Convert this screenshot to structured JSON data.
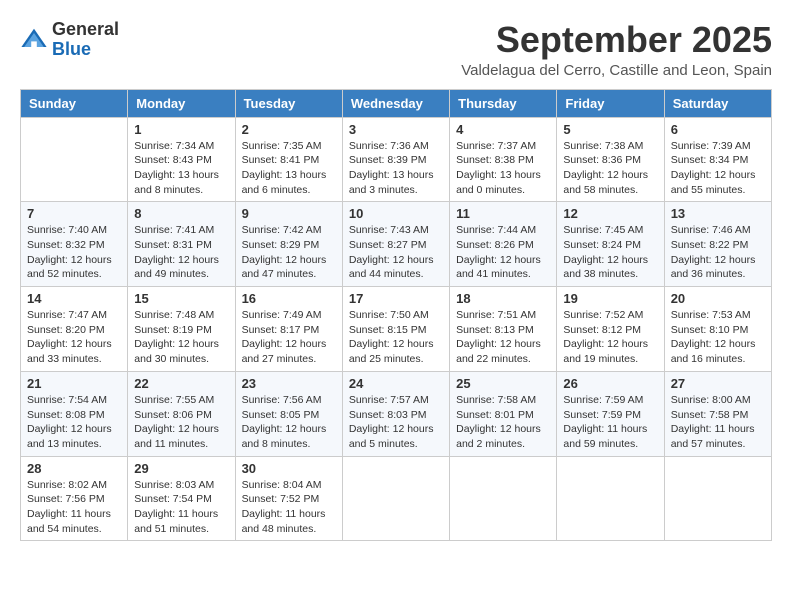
{
  "logo": {
    "general": "General",
    "blue": "Blue"
  },
  "title": "September 2025",
  "location": "Valdelagua del Cerro, Castille and Leon, Spain",
  "days_of_week": [
    "Sunday",
    "Monday",
    "Tuesday",
    "Wednesday",
    "Thursday",
    "Friday",
    "Saturday"
  ],
  "weeks": [
    [
      {
        "day": null
      },
      {
        "day": 1,
        "sunrise": "Sunrise: 7:34 AM",
        "sunset": "Sunset: 8:43 PM",
        "daylight": "Daylight: 13 hours and 8 minutes."
      },
      {
        "day": 2,
        "sunrise": "Sunrise: 7:35 AM",
        "sunset": "Sunset: 8:41 PM",
        "daylight": "Daylight: 13 hours and 6 minutes."
      },
      {
        "day": 3,
        "sunrise": "Sunrise: 7:36 AM",
        "sunset": "Sunset: 8:39 PM",
        "daylight": "Daylight: 13 hours and 3 minutes."
      },
      {
        "day": 4,
        "sunrise": "Sunrise: 7:37 AM",
        "sunset": "Sunset: 8:38 PM",
        "daylight": "Daylight: 13 hours and 0 minutes."
      },
      {
        "day": 5,
        "sunrise": "Sunrise: 7:38 AM",
        "sunset": "Sunset: 8:36 PM",
        "daylight": "Daylight: 12 hours and 58 minutes."
      },
      {
        "day": 6,
        "sunrise": "Sunrise: 7:39 AM",
        "sunset": "Sunset: 8:34 PM",
        "daylight": "Daylight: 12 hours and 55 minutes."
      }
    ],
    [
      {
        "day": 7,
        "sunrise": "Sunrise: 7:40 AM",
        "sunset": "Sunset: 8:32 PM",
        "daylight": "Daylight: 12 hours and 52 minutes."
      },
      {
        "day": 8,
        "sunrise": "Sunrise: 7:41 AM",
        "sunset": "Sunset: 8:31 PM",
        "daylight": "Daylight: 12 hours and 49 minutes."
      },
      {
        "day": 9,
        "sunrise": "Sunrise: 7:42 AM",
        "sunset": "Sunset: 8:29 PM",
        "daylight": "Daylight: 12 hours and 47 minutes."
      },
      {
        "day": 10,
        "sunrise": "Sunrise: 7:43 AM",
        "sunset": "Sunset: 8:27 PM",
        "daylight": "Daylight: 12 hours and 44 minutes."
      },
      {
        "day": 11,
        "sunrise": "Sunrise: 7:44 AM",
        "sunset": "Sunset: 8:26 PM",
        "daylight": "Daylight: 12 hours and 41 minutes."
      },
      {
        "day": 12,
        "sunrise": "Sunrise: 7:45 AM",
        "sunset": "Sunset: 8:24 PM",
        "daylight": "Daylight: 12 hours and 38 minutes."
      },
      {
        "day": 13,
        "sunrise": "Sunrise: 7:46 AM",
        "sunset": "Sunset: 8:22 PM",
        "daylight": "Daylight: 12 hours and 36 minutes."
      }
    ],
    [
      {
        "day": 14,
        "sunrise": "Sunrise: 7:47 AM",
        "sunset": "Sunset: 8:20 PM",
        "daylight": "Daylight: 12 hours and 33 minutes."
      },
      {
        "day": 15,
        "sunrise": "Sunrise: 7:48 AM",
        "sunset": "Sunset: 8:19 PM",
        "daylight": "Daylight: 12 hours and 30 minutes."
      },
      {
        "day": 16,
        "sunrise": "Sunrise: 7:49 AM",
        "sunset": "Sunset: 8:17 PM",
        "daylight": "Daylight: 12 hours and 27 minutes."
      },
      {
        "day": 17,
        "sunrise": "Sunrise: 7:50 AM",
        "sunset": "Sunset: 8:15 PM",
        "daylight": "Daylight: 12 hours and 25 minutes."
      },
      {
        "day": 18,
        "sunrise": "Sunrise: 7:51 AM",
        "sunset": "Sunset: 8:13 PM",
        "daylight": "Daylight: 12 hours and 22 minutes."
      },
      {
        "day": 19,
        "sunrise": "Sunrise: 7:52 AM",
        "sunset": "Sunset: 8:12 PM",
        "daylight": "Daylight: 12 hours and 19 minutes."
      },
      {
        "day": 20,
        "sunrise": "Sunrise: 7:53 AM",
        "sunset": "Sunset: 8:10 PM",
        "daylight": "Daylight: 12 hours and 16 minutes."
      }
    ],
    [
      {
        "day": 21,
        "sunrise": "Sunrise: 7:54 AM",
        "sunset": "Sunset: 8:08 PM",
        "daylight": "Daylight: 12 hours and 13 minutes."
      },
      {
        "day": 22,
        "sunrise": "Sunrise: 7:55 AM",
        "sunset": "Sunset: 8:06 PM",
        "daylight": "Daylight: 12 hours and 11 minutes."
      },
      {
        "day": 23,
        "sunrise": "Sunrise: 7:56 AM",
        "sunset": "Sunset: 8:05 PM",
        "daylight": "Daylight: 12 hours and 8 minutes."
      },
      {
        "day": 24,
        "sunrise": "Sunrise: 7:57 AM",
        "sunset": "Sunset: 8:03 PM",
        "daylight": "Daylight: 12 hours and 5 minutes."
      },
      {
        "day": 25,
        "sunrise": "Sunrise: 7:58 AM",
        "sunset": "Sunset: 8:01 PM",
        "daylight": "Daylight: 12 hours and 2 minutes."
      },
      {
        "day": 26,
        "sunrise": "Sunrise: 7:59 AM",
        "sunset": "Sunset: 7:59 PM",
        "daylight": "Daylight: 11 hours and 59 minutes."
      },
      {
        "day": 27,
        "sunrise": "Sunrise: 8:00 AM",
        "sunset": "Sunset: 7:58 PM",
        "daylight": "Daylight: 11 hours and 57 minutes."
      }
    ],
    [
      {
        "day": 28,
        "sunrise": "Sunrise: 8:02 AM",
        "sunset": "Sunset: 7:56 PM",
        "daylight": "Daylight: 11 hours and 54 minutes."
      },
      {
        "day": 29,
        "sunrise": "Sunrise: 8:03 AM",
        "sunset": "Sunset: 7:54 PM",
        "daylight": "Daylight: 11 hours and 51 minutes."
      },
      {
        "day": 30,
        "sunrise": "Sunrise: 8:04 AM",
        "sunset": "Sunset: 7:52 PM",
        "daylight": "Daylight: 11 hours and 48 minutes."
      },
      {
        "day": null
      },
      {
        "day": null
      },
      {
        "day": null
      },
      {
        "day": null
      }
    ]
  ]
}
